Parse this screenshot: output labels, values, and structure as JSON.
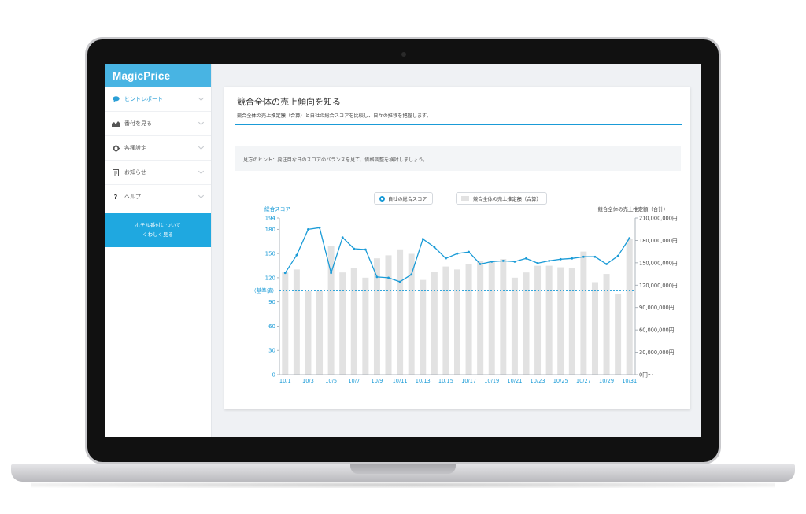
{
  "brand": {
    "name": "MagicPrice"
  },
  "sidebar": {
    "items": [
      {
        "label": "ヒントレポート",
        "icon": "speech-bubble-icon",
        "active": true
      },
      {
        "label": "番付を見る",
        "icon": "area-chart-icon"
      },
      {
        "label": "各種設定",
        "icon": "gear-icon"
      },
      {
        "label": "お知らせ",
        "icon": "document-icon"
      },
      {
        "label": "ヘルプ",
        "icon": "question-icon"
      }
    ],
    "cta_line1": "ホテル番付について",
    "cta_line2": "くわしく見る"
  },
  "card": {
    "title": "競合全体の売上傾向を知る",
    "subtitle": "競合全体の売上推定額（合算）と自社の総合スコアを比較し、日々の推移を把握します。",
    "hint": "見方のヒント：要注目な日のスコアのバランスを見て、価格調整を検討しましょう。"
  },
  "legend": {
    "score": "自社の総合スコア",
    "sales": "競合全体の売上推定額（合算）"
  },
  "colors": {
    "accent": "#1a9bd7",
    "bar": "#e2e2e2",
    "brand": "#48b4e3"
  },
  "chart_data": {
    "type": "bar",
    "combined_with": "line",
    "left_axis_title": "総合スコア",
    "right_axis_title": "競合全体の売上推定額（合計）",
    "baseline_label": "（基準値）",
    "baseline_value": 100,
    "left_ylim": [
      0,
      194
    ],
    "left_ticks": [
      "0",
      "30",
      "60",
      "90",
      "120",
      "150",
      "180",
      "194"
    ],
    "right_ylim": [
      0,
      210000000
    ],
    "right_ticks": [
      "0円〜",
      "30,000,000円",
      "60,000,000円",
      "90,000,000円",
      "120,000,000円",
      "150,000,000円",
      "180,000,000円",
      "210,000,000円"
    ],
    "x_tick_labels": [
      "10/1",
      "10/3",
      "10/5",
      "10/7",
      "10/9",
      "10/11",
      "10/13",
      "10/15",
      "10/17",
      "10/19",
      "10/21",
      "10/23",
      "10/25",
      "10/27",
      "10/29",
      "10/31"
    ],
    "categories": [
      "10/1",
      "10/2",
      "10/3",
      "10/4",
      "10/5",
      "10/6",
      "10/7",
      "10/8",
      "10/9",
      "10/10",
      "10/11",
      "10/12",
      "10/13",
      "10/14",
      "10/15",
      "10/16",
      "10/17",
      "10/18",
      "10/19",
      "10/20",
      "10/21",
      "10/22",
      "10/23",
      "10/24",
      "10/25",
      "10/26",
      "10/27",
      "10/28",
      "10/29",
      "10/30",
      "10/31"
    ],
    "series": [
      {
        "name": "競合全体の売上推定額（合算）",
        "type": "bar",
        "axis": "right",
        "values": [
          137000000,
          141000000,
          112000000,
          112000000,
          173000000,
          137000000,
          143000000,
          130000000,
          156000000,
          160000000,
          168000000,
          162000000,
          127000000,
          138000000,
          145000000,
          141000000,
          148000000,
          153000000,
          153000000,
          155000000,
          130000000,
          137000000,
          146000000,
          146000000,
          144000000,
          143000000,
          165000000,
          124000000,
          135000000,
          108000000,
          182000000
        ]
      },
      {
        "name": "自社の総合スコア",
        "type": "line",
        "axis": "left",
        "values": [
          126,
          148,
          180,
          182,
          126,
          170,
          156,
          155,
          121,
          120,
          115,
          124,
          168,
          158,
          144,
          150,
          152,
          137,
          140,
          141,
          140,
          144,
          138,
          141,
          143,
          144,
          146,
          146,
          137,
          147,
          169
        ]
      }
    ]
  }
}
